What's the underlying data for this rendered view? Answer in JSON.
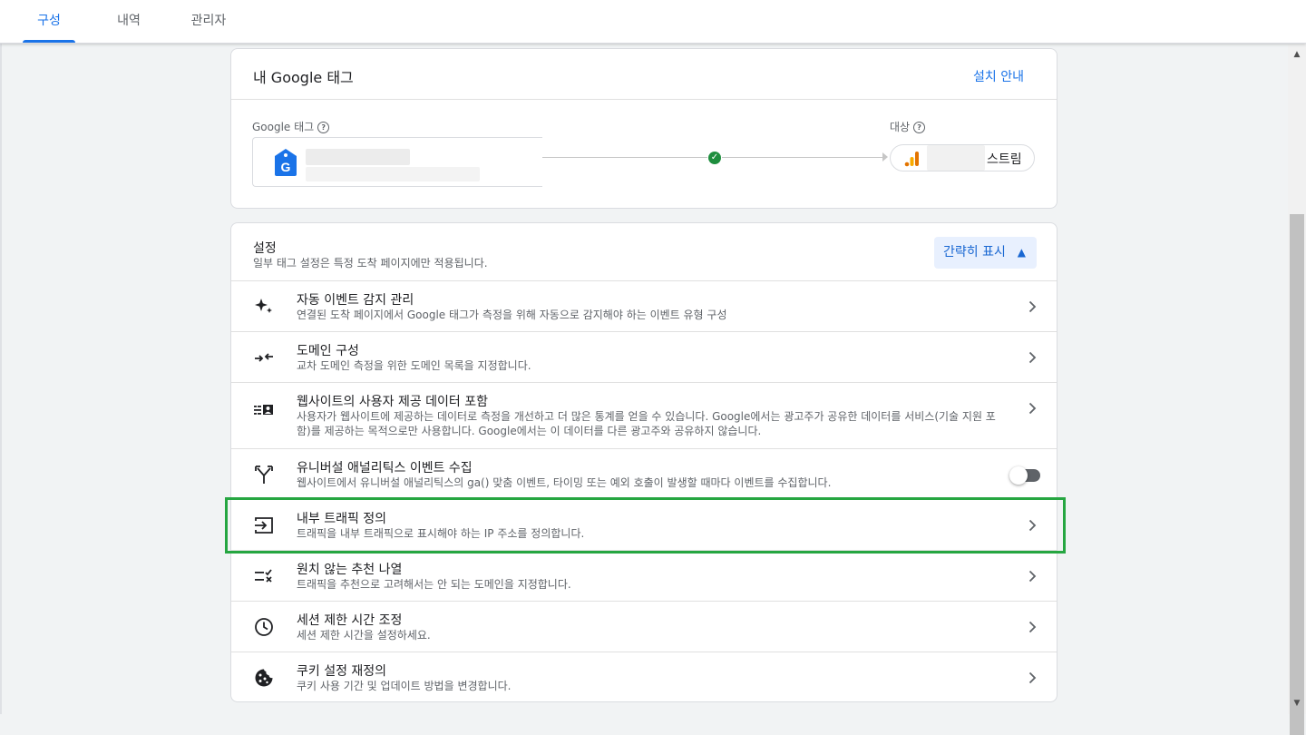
{
  "tabs": [
    {
      "label": "구성",
      "active": true
    },
    {
      "label": "내역",
      "active": false
    },
    {
      "label": "관리자",
      "active": false
    }
  ],
  "tag_card": {
    "title": "내 Google 태그",
    "install_link": "설치 안내",
    "google_tag_label": "Google 태그",
    "destination_label": "대상",
    "stream_name": "스트림",
    "status": "connected"
  },
  "settings": {
    "title": "설정",
    "subtitle": "일부 태그 설정은 특정 도착 페이지에만 적용됩니다.",
    "collapse_button": "간략히 표시",
    "items": [
      {
        "title": "자동 이벤트 감지 관리",
        "desc": "연결된 도착 페이지에서 Google 태그가 측정을 위해 자동으로 감지해야 하는 이벤트 유형 구성",
        "icon": "sparkle-icon",
        "control": "chevron"
      },
      {
        "title": "도메인 구성",
        "desc": "교차 도메인 측정을 위한 도메인 목록을 지정합니다.",
        "icon": "merge-arrows-icon",
        "control": "chevron"
      },
      {
        "title": "웹사이트의 사용자 제공 데이터 포함",
        "desc": "사용자가 웹사이트에 제공하는 데이터로 측정을 개선하고 더 많은 통계를 얻을 수 있습니다. Google에서는 광고주가 공유한 데이터를 서비스(기술 지원 포함)를 제공하는 목적으로만 사용합니다. Google에서는 이 데이터를 다른 광고주와 공유하지 않습니다.",
        "icon": "contact-data-icon",
        "control": "chevron"
      },
      {
        "title": "유니버설 애널리틱스 이벤트 수집",
        "desc": "웹사이트에서 유니버설 애널리틱스의 ga() 맞춤 이벤트, 타이밍 또는 예외 호출이 발생할 때마다 이벤트를 수집합니다.",
        "icon": "fork-icon",
        "control": "toggle"
      },
      {
        "title": "내부 트래픽 정의",
        "desc": "트래픽을 내부 트래픽으로 표시해야 하는 IP 주소를 정의합니다.",
        "icon": "login-arrow-icon",
        "control": "chevron"
      },
      {
        "title": "원치 않는 추천 나열",
        "desc": "트래픽을 추천으로 고려해서는 안 되는 도메인을 지정합니다.",
        "icon": "rule-list-icon",
        "control": "chevron"
      },
      {
        "title": "세션 제한 시간 조정",
        "desc": "세션 제한 시간을 설정하세요.",
        "icon": "clock-icon",
        "control": "chevron"
      },
      {
        "title": "쿠키 설정 재정의",
        "desc": "쿠키 사용 기간 및 업데이트 방법을 변경합니다.",
        "icon": "cookie-icon",
        "control": "chevron"
      }
    ]
  },
  "colors": {
    "accent": "#1a73e8",
    "highlight": "#26a641",
    "success": "#1e8e3e"
  }
}
